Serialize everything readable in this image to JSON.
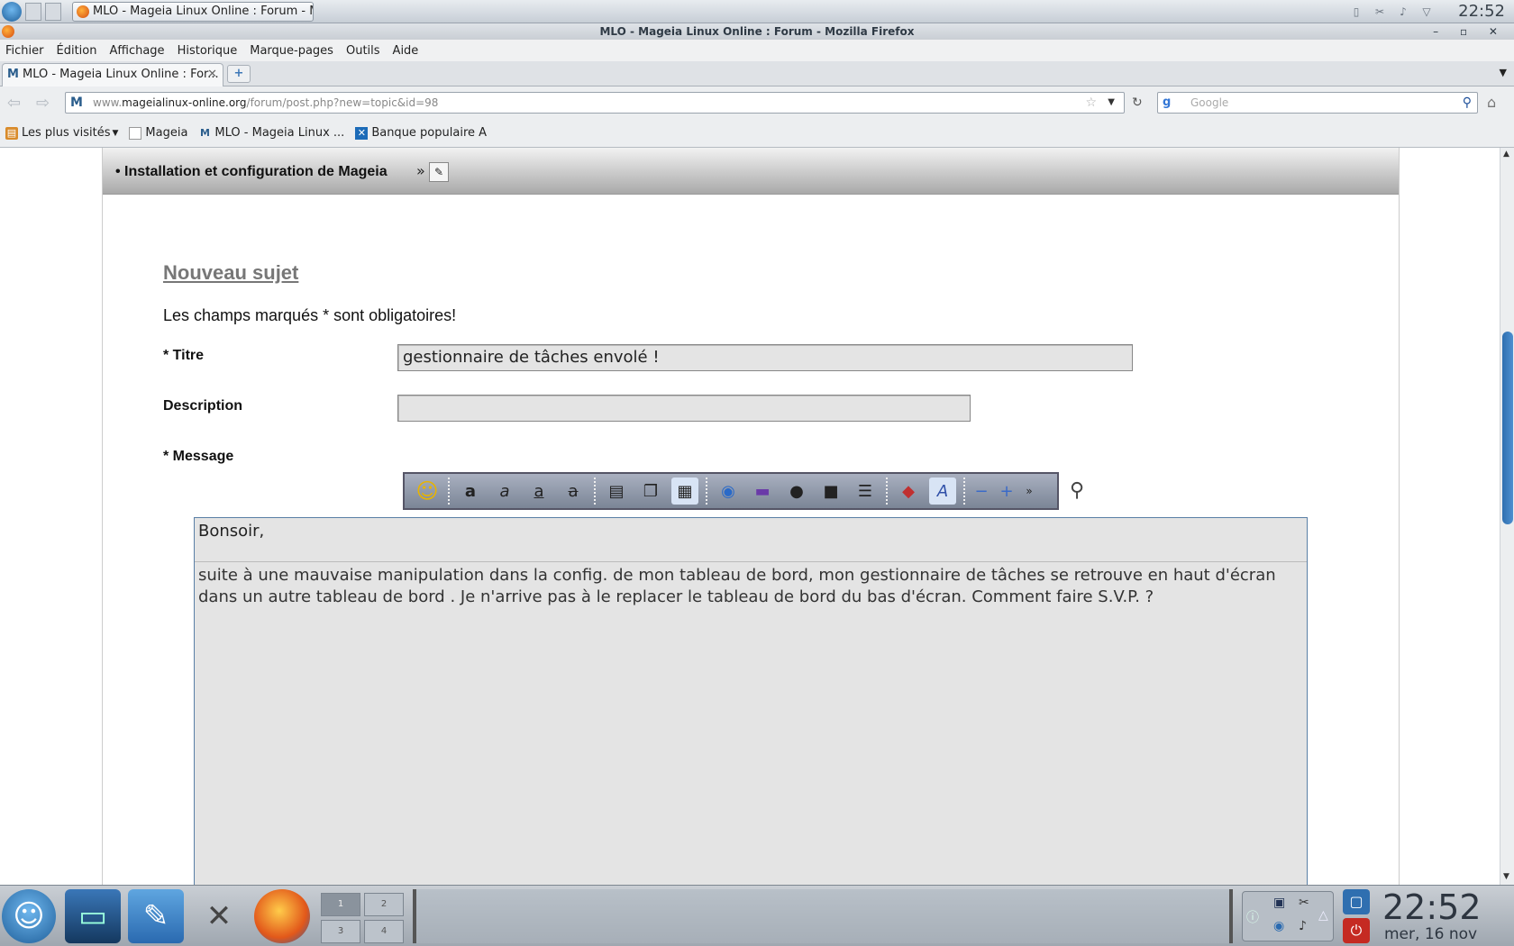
{
  "top_panel": {
    "task_title": "MLO - Mageia Linux Online : Forum - M",
    "clock": "22:52",
    "tray_icons": [
      "clipboard-icon",
      "scissors-icon",
      "volume-icon",
      "network-icon"
    ]
  },
  "window": {
    "title": "MLO - Mageia Linux Online : Forum - Mozilla Firefox",
    "controls": "– ▫ ✕"
  },
  "menu": [
    "Fichier",
    "Édition",
    "Affichage",
    "Historique",
    "Marque-pages",
    "Outils",
    "Aide"
  ],
  "tab": {
    "title": "MLO - Mageia Linux Online : For...",
    "icon": "M",
    "close": "✕",
    "newtab": "+"
  },
  "nav": {
    "url_prefix": "www.",
    "url_domain": "mageialinux-online.org",
    "url_path": "/forum/post.php?new=topic&id=98",
    "search_engine": "g",
    "search_placeholder": "Google"
  },
  "bookmarks": [
    {
      "label": "Les plus visités",
      "icon": "folder-icon"
    },
    {
      "label": "Mageia",
      "icon": "page-icon"
    },
    {
      "label": "MLO - Mageia Linux ...",
      "icon": "mlo-icon"
    },
    {
      "label": "Banque populaire A",
      "icon": "bank-icon"
    }
  ],
  "forum": {
    "breadcrumb": "• Installation et configuration de Mageia",
    "raquo": "»",
    "heading": "Nouveau sujet",
    "required_notice": "Les champs marqués * sont obligatoires!",
    "title_label": "* Titre",
    "title_value": "gestionnaire de tâches envolé !",
    "description_label": "Description",
    "description_value": "",
    "message_label": "* Message",
    "message_line1": "Bonsoir,",
    "message_body": "suite à une mauvaise manipulation dans la config. de mon tableau de bord, mon gestionnaire de tâches se retrouve en haut d'écran dans un autre tableau de bord . Je n'arrive pas à le replacer le tableau de bord du bas d'écran. Comment faire S.V.P. ?"
  },
  "toolbar_icons": [
    "smiley-icon",
    "bold-icon",
    "italic-icon",
    "underline-icon",
    "strike-icon",
    "sep",
    "align-icon",
    "copy-icon",
    "page-icon",
    "sep",
    "link-icon",
    "image-icon",
    "quote-icon",
    "lock-icon",
    "list-icon",
    "sep",
    "color-icon",
    "font-icon",
    "sep",
    "minus-icon",
    "plus-icon",
    "more-icon"
  ],
  "bottom_panel": {
    "pager": [
      "1",
      "2",
      "3",
      "4"
    ],
    "clock": "22:52",
    "date": "mer, 16 nov"
  }
}
